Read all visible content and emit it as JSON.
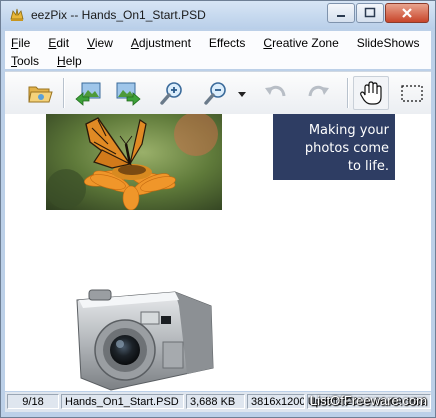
{
  "window": {
    "title": "eezPix -- Hands_On1_Start.PSD",
    "colors": {
      "frame": "#bcd0e8",
      "slogan_bg": "#2e3d63",
      "close_button": "#c8452a"
    }
  },
  "menu": {
    "row1": [
      {
        "label": "File",
        "accel": "F",
        "rest": "ile"
      },
      {
        "label": "Edit",
        "accel": "E",
        "rest": "dit"
      },
      {
        "label": "View",
        "accel": "V",
        "rest": "iew"
      },
      {
        "label": "Adjustment",
        "accel": "A",
        "rest": "djustment"
      },
      {
        "label": "Effects",
        "accel": "",
        "rest": "Effects"
      },
      {
        "label": "Creative Zone",
        "accel": "C",
        "rest": "reative Zone"
      },
      {
        "label": "SlideShows",
        "accel": "",
        "rest": "SlideShows"
      }
    ],
    "row2": [
      {
        "label": "Tools",
        "accel": "T",
        "rest": "ools"
      },
      {
        "label": "Help",
        "accel": "H",
        "rest": "elp"
      }
    ]
  },
  "toolbar": {
    "buttons": [
      {
        "name": "open-folder-icon"
      },
      {
        "name": "previous-image-icon"
      },
      {
        "name": "next-image-icon"
      },
      {
        "name": "zoom-in-icon"
      },
      {
        "name": "zoom-out-icon"
      },
      {
        "name": "zoom-dropdown-icon"
      },
      {
        "name": "undo-icon"
      },
      {
        "name": "redo-icon"
      },
      {
        "name": "hand-pan-icon"
      },
      {
        "name": "selection-marquee-icon"
      }
    ]
  },
  "canvas": {
    "slogan": "Making your\nphotos come\nto life."
  },
  "status": {
    "position": "9/18",
    "filename": "Hands_On1_Start.PSD",
    "filesize": "3,688 KB",
    "dimensions": "3816x1200",
    "date": "Update:2014-09-09 16:2",
    "watermark": "ListOfFreeware.com"
  }
}
